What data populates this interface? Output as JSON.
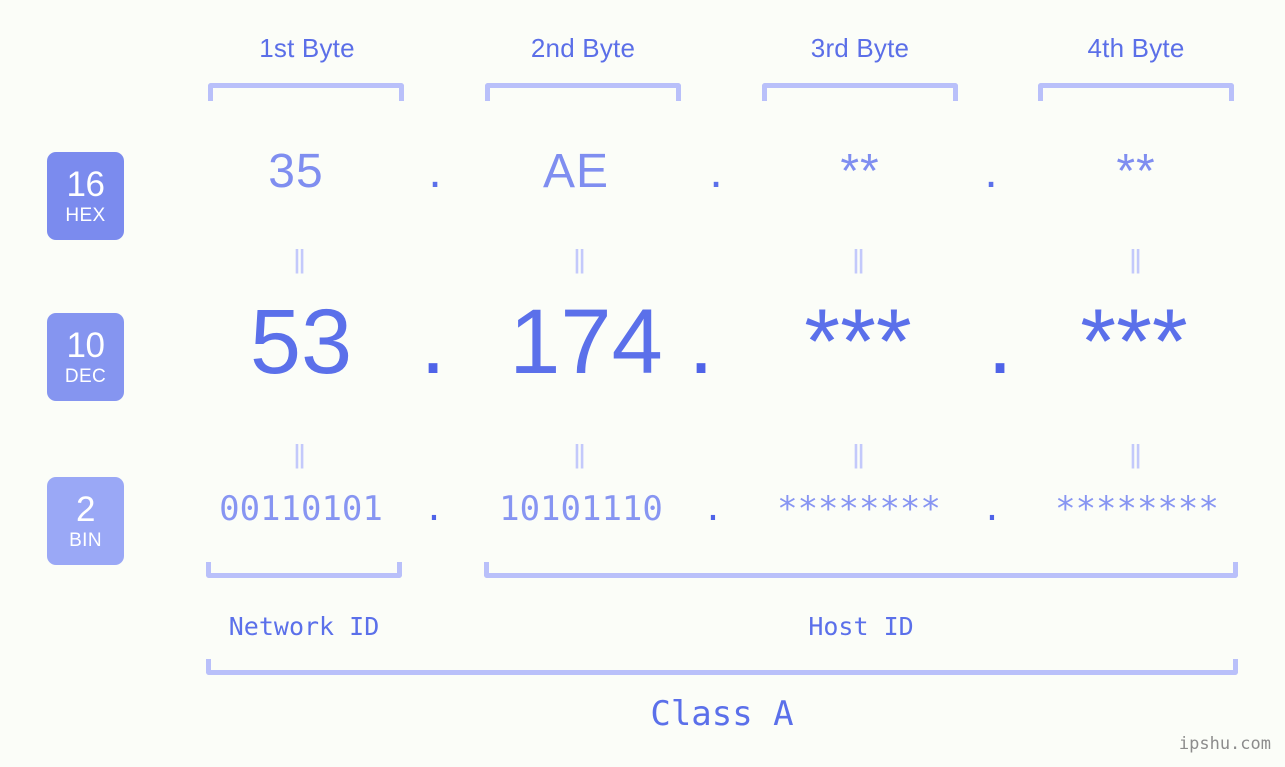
{
  "headers": [
    {
      "label": "1st Byte"
    },
    {
      "label": "2nd Byte"
    },
    {
      "label": "3rd Byte"
    },
    {
      "label": "4th Byte"
    }
  ],
  "bases": [
    {
      "num": "16",
      "label": "HEX",
      "color": "#7b8bee"
    },
    {
      "num": "10",
      "label": "DEC",
      "color": "#8595f0"
    },
    {
      "num": "2",
      "label": "BIN",
      "color": "#9aa8f6"
    }
  ],
  "rows": {
    "hex": {
      "base_num": "16",
      "base_label": "HEX",
      "values": [
        "35",
        "AE",
        "**",
        "**"
      ],
      "separators": [
        ".",
        ".",
        "."
      ]
    },
    "dec": {
      "base_num": "10",
      "base_label": "DEC",
      "values": [
        "53",
        "174",
        "***",
        "***"
      ],
      "separators": [
        ".",
        ".",
        "."
      ]
    },
    "bin": {
      "base_num": "2",
      "base_label": "BIN",
      "values": [
        "00110101",
        "10101110",
        "********",
        "********"
      ],
      "separators": [
        ".",
        ".",
        "."
      ]
    }
  },
  "equals": {
    "glyph": "ǁ",
    "hex_to_dec": [
      "ǁ",
      "ǁ",
      "ǁ",
      "ǁ"
    ],
    "dec_to_bin": [
      "ǁ",
      "ǁ",
      "ǁ",
      "ǁ"
    ]
  },
  "spans": {
    "network_id": "Network ID",
    "host_id": "Host ID",
    "class": "Class A"
  },
  "watermark": "ipshu.com",
  "colors": {
    "background": "#fbfdf8",
    "accent": "#5b70ea",
    "accent_light": "#8795f2",
    "bracket": "#b9c0fa",
    "badge_hex": "#7b8bee",
    "badge_dec": "#8595f0",
    "badge_bin": "#9aa8f6",
    "equals": "#c3c9fb",
    "watermark": "#8c8c8c"
  }
}
